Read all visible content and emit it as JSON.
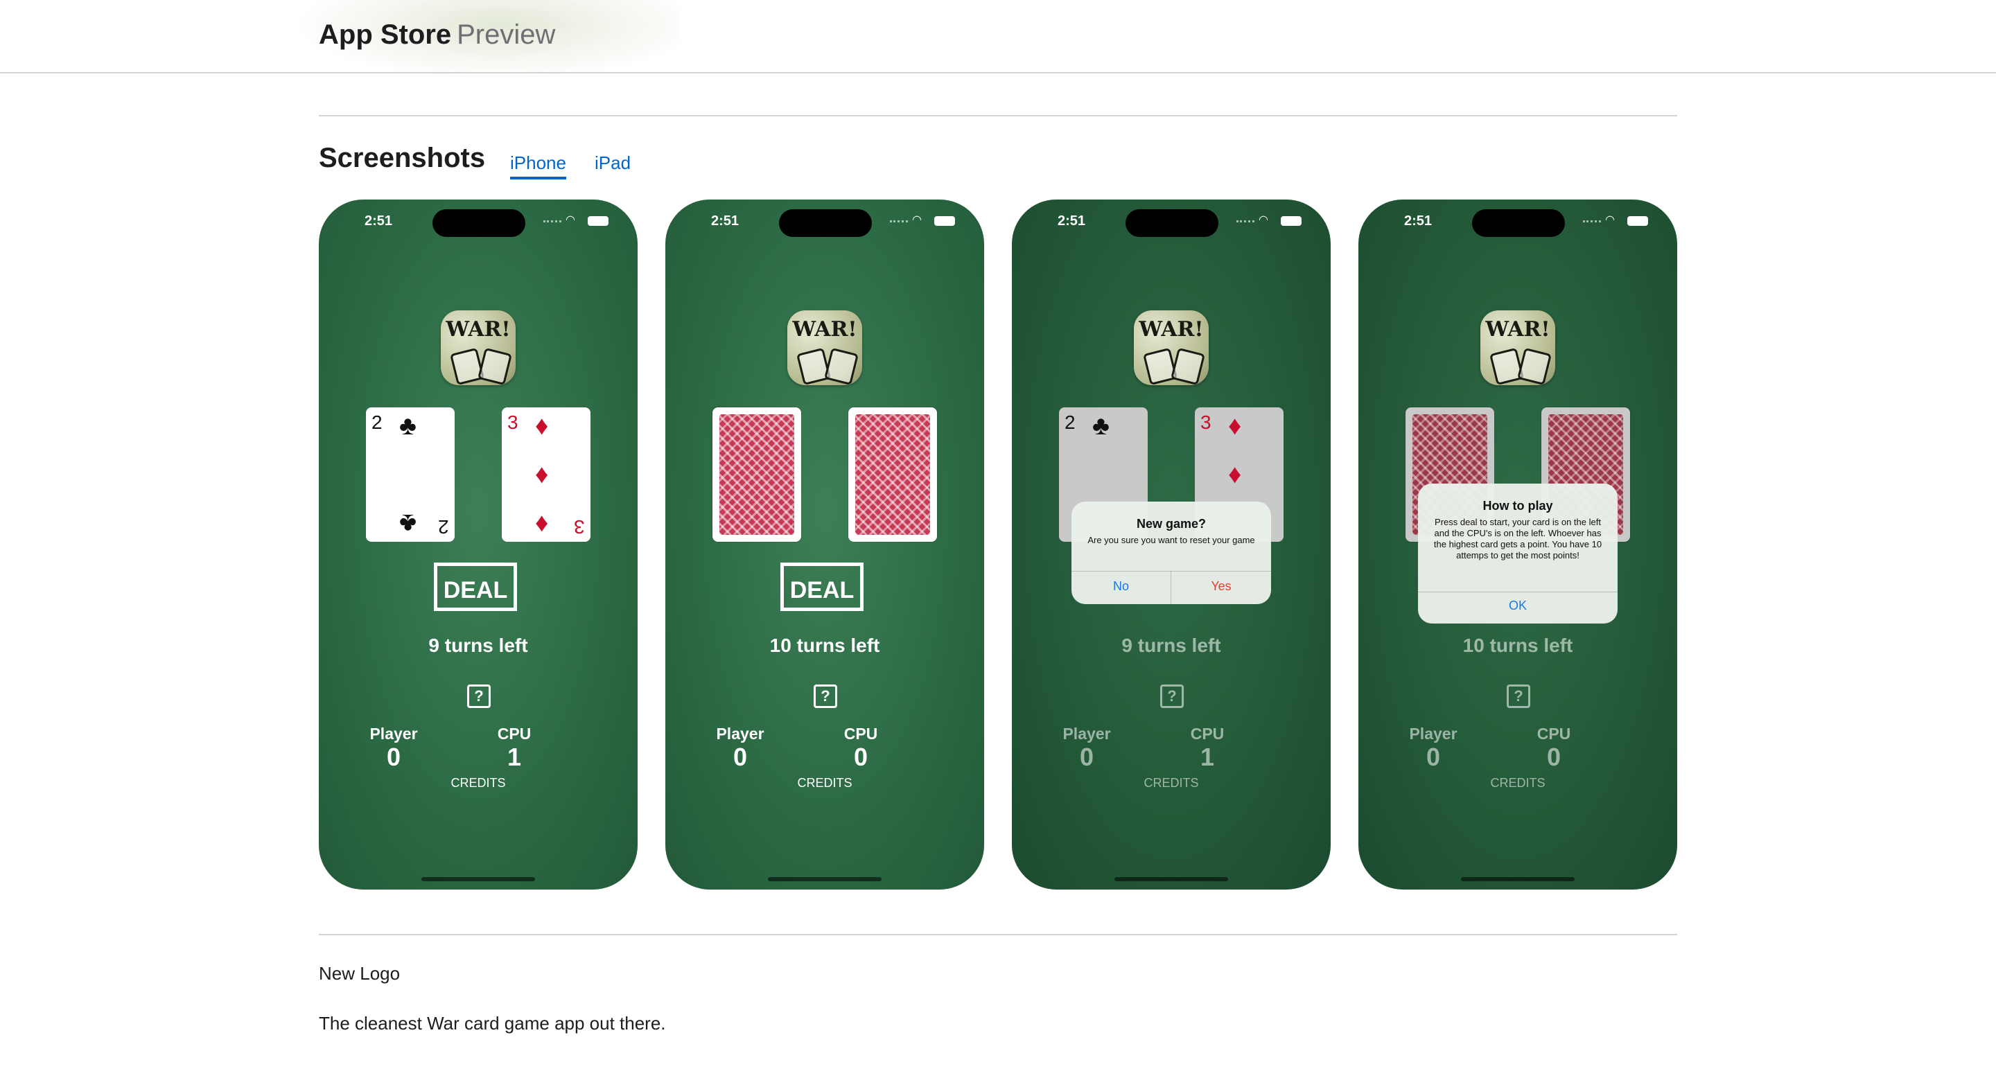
{
  "header": {
    "brand": "App Store",
    "subtitle": "Preview"
  },
  "screenshots": {
    "title": "Screenshots",
    "tabs": [
      {
        "label": "iPhone",
        "active": true
      },
      {
        "label": "iPad",
        "active": false
      }
    ]
  },
  "phones": [
    {
      "time": "2:51",
      "logo_text": "WAR!",
      "player_card": {
        "rank": "2",
        "suit": "♣"
      },
      "cpu_card": {
        "rank": "3",
        "suit": "♦"
      },
      "deal_label": "DEAL",
      "turns": "9 turns left",
      "help": "?",
      "player_label": "Player",
      "cpu_label": "CPU",
      "player_score": "0",
      "cpu_score": "1",
      "credits": "CREDITS"
    },
    {
      "time": "2:51",
      "logo_text": "WAR!",
      "deal_label": "DEAL",
      "turns": "10 turns left",
      "help": "?",
      "player_label": "Player",
      "cpu_label": "CPU",
      "player_score": "0",
      "cpu_score": "0",
      "credits": "CREDITS"
    },
    {
      "time": "2:51",
      "logo_text": "WAR!",
      "player_card": {
        "rank": "2",
        "suit": "♣"
      },
      "cpu_card": {
        "rank": "3",
        "suit": "♦"
      },
      "turns": "9 turns left",
      "help": "?",
      "player_label": "Player",
      "cpu_label": "CPU",
      "player_score": "0",
      "cpu_score": "1",
      "credits": "CREDITS",
      "dialog": {
        "title": "New game?",
        "message": "Are you sure you want to reset your game",
        "no": "No",
        "yes": "Yes"
      }
    },
    {
      "time": "2:51",
      "logo_text": "WAR!",
      "turns": "10 turns left",
      "help": "?",
      "player_label": "Player",
      "cpu_label": "CPU",
      "player_score": "0",
      "cpu_score": "0",
      "credits": "CREDITS",
      "dialog": {
        "title": "How to play",
        "message": "Press deal to start, your card is on the left and the CPU's is on the left. Whoever has the highest card gets a point. You have 10 attemps to get the most points!",
        "ok": "OK"
      }
    }
  ],
  "description": {
    "whats_new": "New Logo",
    "tagline": "The cleanest War card game app out there."
  }
}
